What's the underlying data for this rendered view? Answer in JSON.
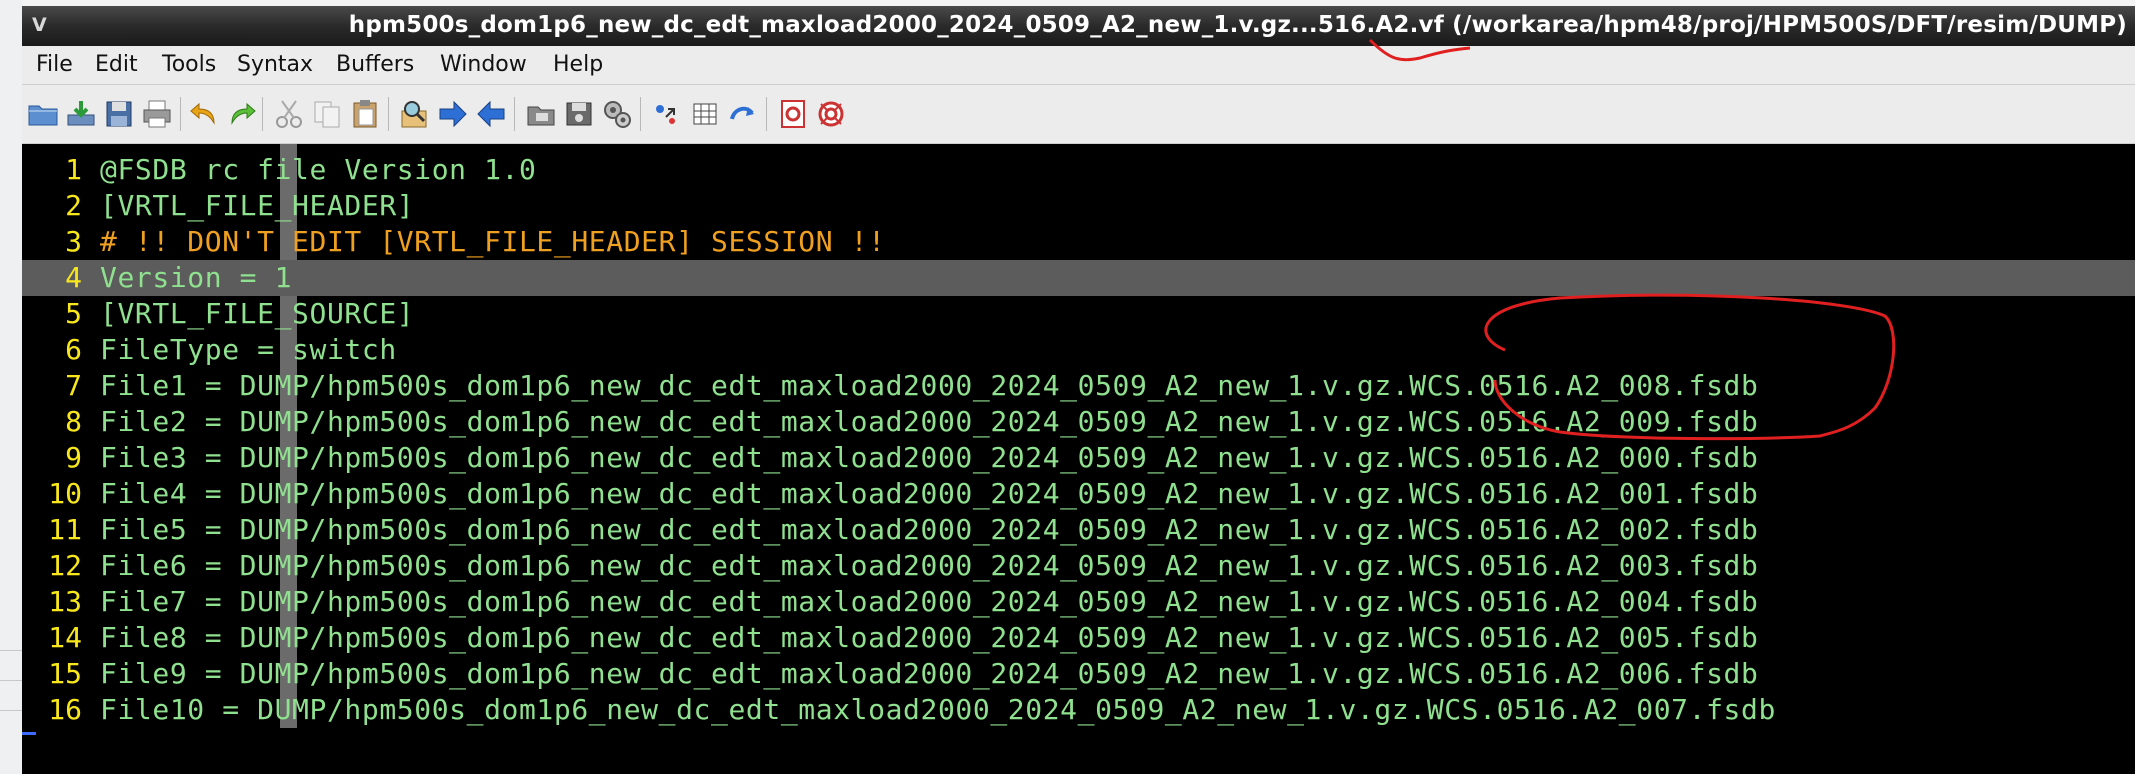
{
  "window": {
    "title": "hpm500s_dom1p6_new_dc_edt_maxload2000_2024_0509_A2_new_1.v.gz...516.A2.vf (/workarea/hpm48/proj/HPM500S/DFT/resim/DUMP)",
    "app_icon": "gvim-icon"
  },
  "menu": {
    "items": [
      "File",
      "Edit",
      "Tools",
      "Syntax",
      "Buffers",
      "Window",
      "Help"
    ]
  },
  "toolbar": {
    "icons": [
      "open-icon",
      "save-download-icon",
      "save-icon",
      "print-icon",
      "undo-icon",
      "redo-icon",
      "cut-icon",
      "copy-icon",
      "paste-icon",
      "find-replace-icon",
      "forward-icon",
      "back-icon",
      "load-session-icon",
      "save-session-icon",
      "run-script-icon",
      "make-icon",
      "tags-icon",
      "jump-tag-icon",
      "help-icon",
      "find-help-icon"
    ]
  },
  "colors": {
    "text_green": "#8fe08f",
    "comment_orange": "#f0a020",
    "line_number_yellow": "#f8e71c",
    "annotation_red": "#e02020",
    "current_line_bg": "#5c5c5c"
  },
  "editor": {
    "lines": [
      {
        "num": "1",
        "text": "@FSDB rc file Version 1.0",
        "kind": "normal"
      },
      {
        "num": "2",
        "text": "[VRTL_FILE_HEADER]",
        "kind": "normal"
      },
      {
        "num": "3",
        "text": "# !! DON'T EDIT [VRTL_FILE_HEADER] SESSION !!",
        "kind": "comment"
      },
      {
        "num": "4",
        "text": "Version = 1",
        "kind": "current"
      },
      {
        "num": "5",
        "text": "[VRTL_FILE_SOURCE]",
        "kind": "normal"
      },
      {
        "num": "6",
        "text": "FileType = switch",
        "kind": "normal"
      },
      {
        "num": "7",
        "text": "File1 = DUMP/hpm500s_dom1p6_new_dc_edt_maxload2000_2024_0509_A2_new_1.v.gz.WCS.0516.A2_008.fsdb",
        "kind": "normal"
      },
      {
        "num": "8",
        "text": "File2 = DUMP/hpm500s_dom1p6_new_dc_edt_maxload2000_2024_0509_A2_new_1.v.gz.WCS.0516.A2_009.fsdb",
        "kind": "normal"
      },
      {
        "num": "9",
        "text": "File3 = DUMP/hpm500s_dom1p6_new_dc_edt_maxload2000_2024_0509_A2_new_1.v.gz.WCS.0516.A2_000.fsdb",
        "kind": "normal"
      },
      {
        "num": "10",
        "text": "File4 = DUMP/hpm500s_dom1p6_new_dc_edt_maxload2000_2024_0509_A2_new_1.v.gz.WCS.0516.A2_001.fsdb",
        "kind": "normal"
      },
      {
        "num": "11",
        "text": "File5 = DUMP/hpm500s_dom1p6_new_dc_edt_maxload2000_2024_0509_A2_new_1.v.gz.WCS.0516.A2_002.fsdb",
        "kind": "normal"
      },
      {
        "num": "12",
        "text": "File6 = DUMP/hpm500s_dom1p6_new_dc_edt_maxload2000_2024_0509_A2_new_1.v.gz.WCS.0516.A2_003.fsdb",
        "kind": "normal"
      },
      {
        "num": "13",
        "text": "File7 = DUMP/hpm500s_dom1p6_new_dc_edt_maxload2000_2024_0509_A2_new_1.v.gz.WCS.0516.A2_004.fsdb",
        "kind": "normal"
      },
      {
        "num": "14",
        "text": "File8 = DUMP/hpm500s_dom1p6_new_dc_edt_maxload2000_2024_0509_A2_new_1.v.gz.WCS.0516.A2_005.fsdb",
        "kind": "normal"
      },
      {
        "num": "15",
        "text": "File9 = DUMP/hpm500s_dom1p6_new_dc_edt_maxload2000_2024_0509_A2_new_1.v.gz.WCS.0516.A2_006.fsdb",
        "kind": "normal"
      },
      {
        "num": "16",
        "text": "File10 = DUMP/hpm500s_dom1p6_new_dc_edt_maxload2000_2024_0509_A2_new_1.v.gz.WCS.0516.A2_007.fsdb",
        "kind": "normal"
      }
    ]
  }
}
